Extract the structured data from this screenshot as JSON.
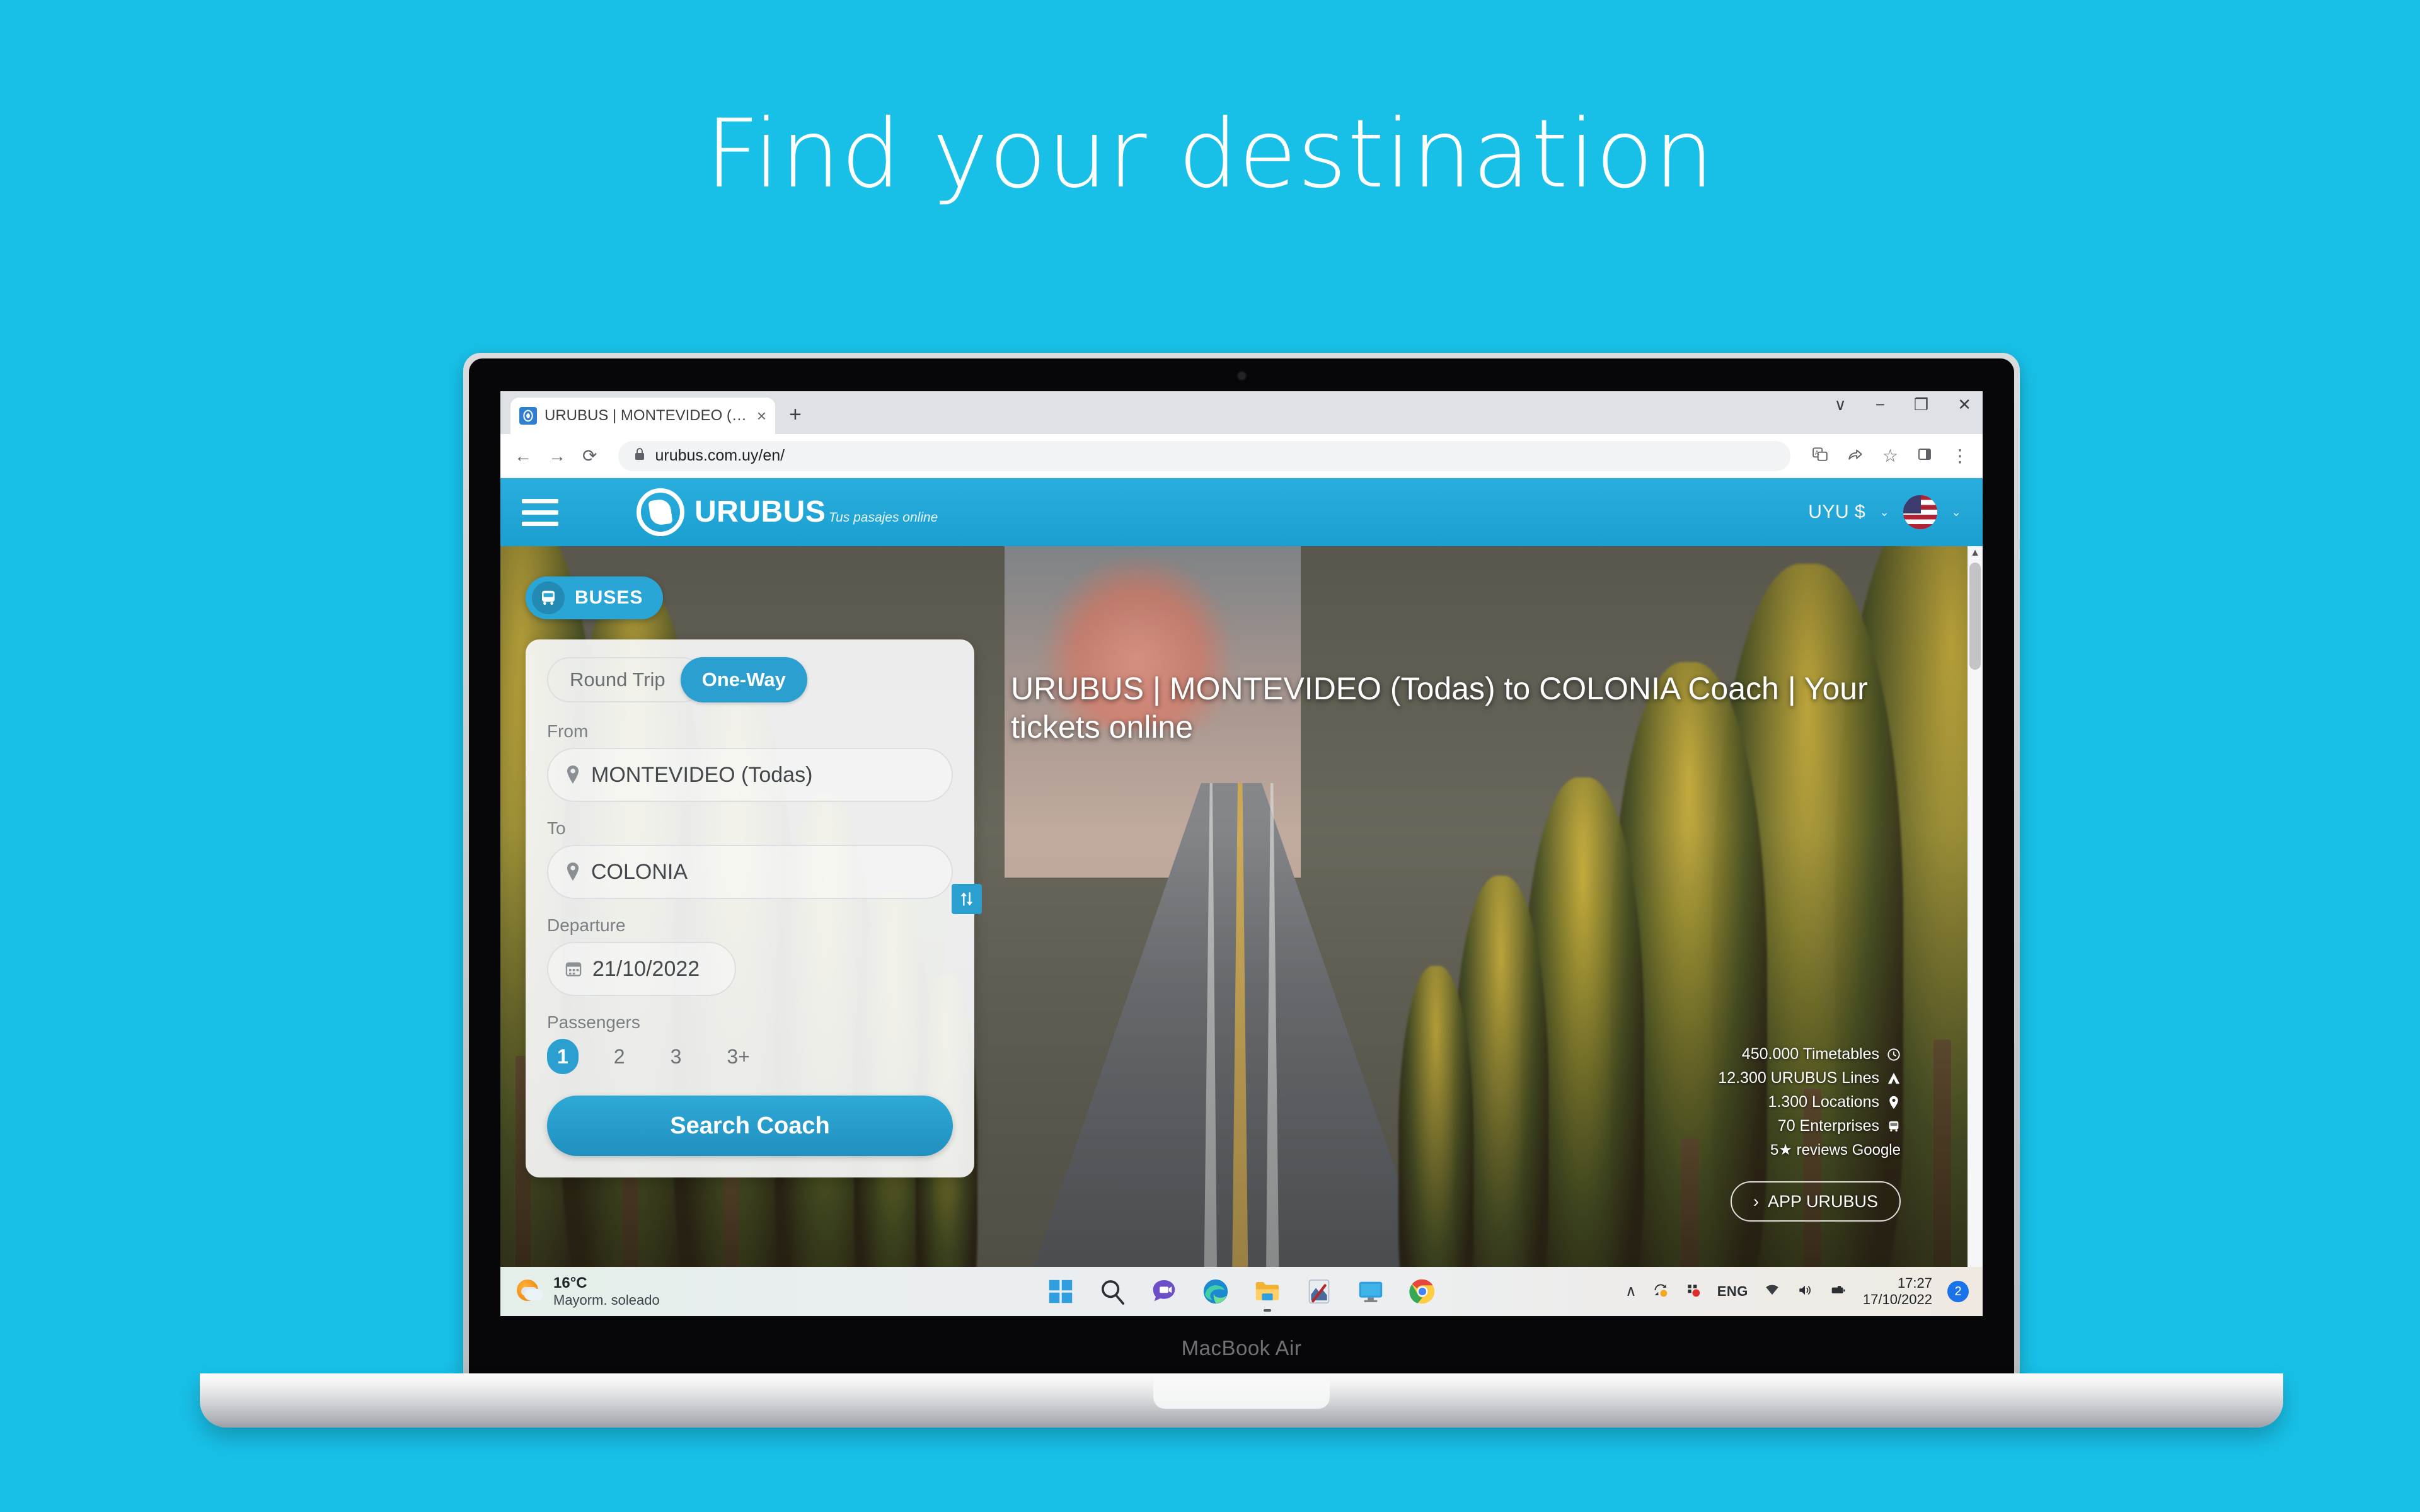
{
  "poster": {
    "title": "Find your destination",
    "background_color": "#18c0e8"
  },
  "device": {
    "model_label": "MacBook Air"
  },
  "browser": {
    "tab": {
      "title": "URUBUS | MONTEVIDEO (Todas)",
      "close_label": "×",
      "favicon_name": "urubus-favicon"
    },
    "new_tab_label": "+",
    "window_controls": {
      "chevron": "∨",
      "minimize": "−",
      "restore": "❐",
      "close": "✕"
    },
    "toolbar": {
      "back": "←",
      "forward": "→",
      "reload": "⟳",
      "lock": "ὑ2",
      "url": "urubus.com.uy/en/",
      "translate": "文",
      "share": "↪",
      "bookmark": "☆",
      "sidepanel": "▧",
      "menu": "⋮"
    }
  },
  "site": {
    "header": {
      "menu_icon": "hamburger-icon",
      "brand_name": "URUBUS",
      "brand_tagline": "Tus pasajes online",
      "currency": "UYU $",
      "currency_chevron": "⌄",
      "language_chevron": "⌄",
      "flag_name": "us-flag-icon"
    },
    "hero": {
      "mode_tab": "BUSES",
      "headline": "URUBUS | MONTEVIDEO (Todas) to COLONIA Coach | Your tickets online",
      "stats": [
        {
          "icon": "clock-icon",
          "text": "450.000 Timetables"
        },
        {
          "icon": "route-icon",
          "text": "12.300 URUBUS Lines"
        },
        {
          "icon": "pin-icon",
          "text": "1.300 Locations"
        },
        {
          "icon": "bus-icon",
          "text": "70 Enterprises"
        },
        {
          "icon": "star-icon",
          "text": "5★  reviews Google"
        }
      ],
      "app_button": "APP URUBUS",
      "app_button_chevron": "›"
    },
    "search_form": {
      "trip_round": "Round Trip",
      "trip_oneway": "One-Way",
      "trip_selected": "One-Way",
      "from_label": "From",
      "from_value": "MONTEVIDEO (Todas)",
      "to_label": "To",
      "to_value": "COLONIA",
      "swap_icon": "swap-vertical-icon",
      "departure_label": "Departure",
      "departure_value": "21/10/2022",
      "passengers_label": "Passengers",
      "passenger_options": [
        "1",
        "2",
        "3",
        "3+"
      ],
      "passengers_selected": "1",
      "submit_label": "Search Coach"
    },
    "scrollbar": {
      "up": "▲",
      "down": "▼"
    }
  },
  "taskbar": {
    "weather_temp": "16°C",
    "weather_desc": "Mayorm. soleado",
    "apps": [
      "windows-start-icon",
      "search-icon",
      "teams-chat-icon",
      "edge-browser-icon",
      "file-explorer-icon",
      "snipping-tool-icon",
      "remote-desktop-icon",
      "chrome-browser-icon"
    ],
    "tray": {
      "overflow": "∧",
      "sync_icon": "onedrive-sync-icon",
      "notify_icon": "dots-status-icon",
      "language": "ENG",
      "wifi": "wifi-icon",
      "volume": "speaker-icon",
      "battery": "battery-icon",
      "time": "17:27",
      "date": "17/10/2022",
      "badge_count": "2"
    }
  }
}
